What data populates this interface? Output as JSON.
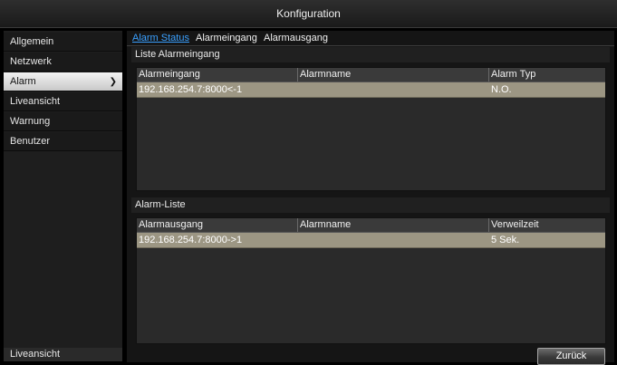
{
  "header": {
    "title": "Konfiguration"
  },
  "sidebar": {
    "items": [
      {
        "label": "Allgemein"
      },
      {
        "label": "Netzwerk"
      },
      {
        "label": "Alarm"
      },
      {
        "label": "Liveansicht"
      },
      {
        "label": "Warnung"
      },
      {
        "label": "Benutzer"
      }
    ],
    "active_item": "Alarm",
    "bottom": {
      "label": "Liveansicht"
    }
  },
  "tabs": [
    {
      "label": "Alarm Status",
      "active": true
    },
    {
      "label": "Alarmeingang",
      "active": false
    },
    {
      "label": "Alarmausgang",
      "active": false
    }
  ],
  "inputs_section": {
    "title": "Liste Alarmeingang",
    "columns": [
      "Alarmeingang",
      "Alarmname",
      "Alarm Typ"
    ],
    "rows": [
      {
        "cells": [
          "192.168.254.7:8000<-1",
          "",
          "N.O."
        ]
      }
    ]
  },
  "outputs_section": {
    "title": "Alarm-Liste",
    "columns": [
      "Alarmausgang",
      "Alarmname",
      "Verweilzeit"
    ],
    "rows": [
      {
        "cells": [
          "192.168.254.7:8000->1",
          "",
          "5 Sek."
        ]
      }
    ]
  },
  "footer": {
    "back_label": "Zurück"
  },
  "colors": {
    "tab_active": "#3aa0ff",
    "row_selected": "#9c9683"
  }
}
